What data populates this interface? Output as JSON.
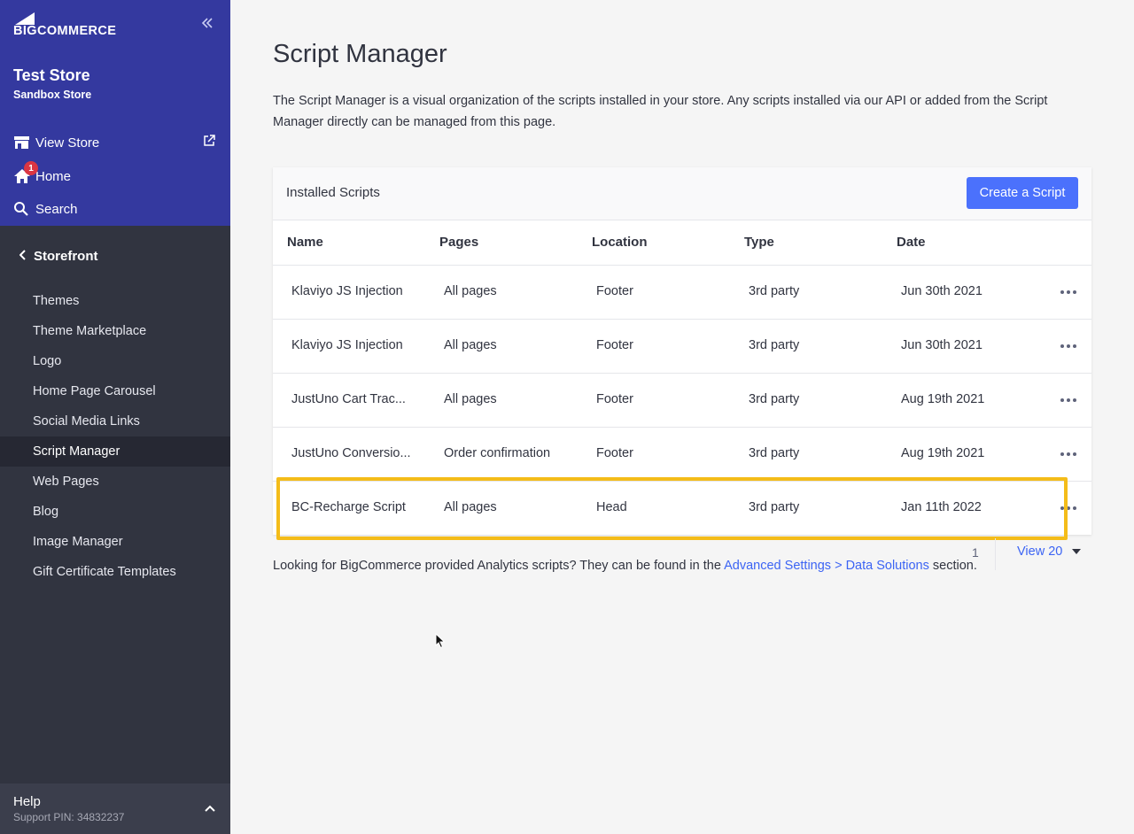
{
  "sidebar": {
    "logo_text": "BIGCOMMERCE",
    "store_name": "Test Store",
    "store_sub": "Sandbox Store",
    "links": {
      "view_store": "View Store",
      "home": "Home",
      "home_badge": "1",
      "search": "Search"
    },
    "section": "Storefront",
    "items": [
      {
        "label": "Themes"
      },
      {
        "label": "Theme Marketplace"
      },
      {
        "label": "Logo"
      },
      {
        "label": "Home Page Carousel"
      },
      {
        "label": "Social Media Links"
      },
      {
        "label": "Script Manager",
        "active": true
      },
      {
        "label": "Web Pages"
      },
      {
        "label": "Blog"
      },
      {
        "label": "Image Manager"
      },
      {
        "label": "Gift Certificate Templates"
      }
    ],
    "help": {
      "title": "Help",
      "pin": "Support PIN: 34832237"
    }
  },
  "main": {
    "title": "Script Manager",
    "description": "The Script Manager is a visual organization of the scripts installed in your store. Any scripts installed via our API or added from the Script Manager directly can be managed from this page.",
    "panel": {
      "title": "Installed Scripts",
      "create_button": "Create a Script",
      "columns": [
        "Name",
        "Pages",
        "Location",
        "Type",
        "Date"
      ],
      "rows": [
        {
          "name": "Klaviyo JS Injection",
          "pages": "All pages",
          "location": "Footer",
          "type": "3rd party",
          "date": "Jun 30th 2021"
        },
        {
          "name": "Klaviyo JS Injection",
          "pages": "All pages",
          "location": "Footer",
          "type": "3rd party",
          "date": "Jun 30th 2021"
        },
        {
          "name": "JustUno Cart Trac...",
          "pages": "All pages",
          "location": "Footer",
          "type": "3rd party",
          "date": "Aug 19th 2021"
        },
        {
          "name": "JustUno Conversio...",
          "pages": "Order confirmation",
          "location": "Footer",
          "type": "3rd party",
          "date": "Aug 19th 2021"
        },
        {
          "name": "BC-Recharge Script",
          "pages": "All pages",
          "location": "Head",
          "type": "3rd party",
          "date": "Jan 11th 2022"
        }
      ]
    },
    "pagination": {
      "page": "1",
      "view": "View 20"
    },
    "footer": {
      "prefix": "Looking for BigCommerce provided Analytics scripts? They can be found in the ",
      "link": "Advanced Settings > Data Solutions",
      "suffix": " section."
    }
  },
  "colors": {
    "sidebar_top": "#34399f",
    "sidebar_bottom": "#313440",
    "primary_button": "#4b71fc",
    "highlight": "#f4bc19",
    "badge": "#db3643",
    "link": "#3c64f4"
  }
}
